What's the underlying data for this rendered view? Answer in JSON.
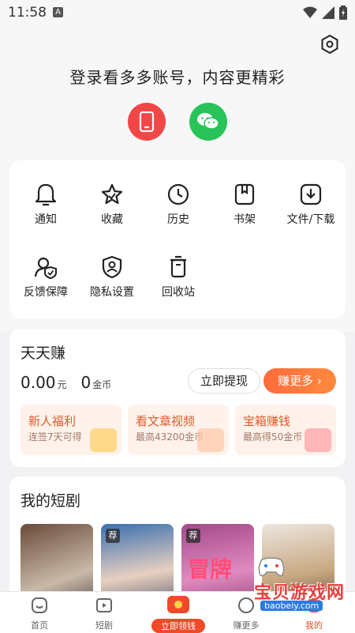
{
  "status_bar": {
    "time": "11:58",
    "notification": "A"
  },
  "login": {
    "title": "登录看多多账号，内容更精彩"
  },
  "tools": [
    {
      "label": "通知",
      "icon": "bell-icon"
    },
    {
      "label": "收藏",
      "icon": "star-icon"
    },
    {
      "label": "历史",
      "icon": "clock-icon"
    },
    {
      "label": "书架",
      "icon": "bookmark-icon"
    },
    {
      "label": "文件/下载",
      "icon": "download-icon"
    },
    {
      "label": "反馈保障",
      "icon": "feedback-icon"
    },
    {
      "label": "隐私设置",
      "icon": "privacy-icon"
    },
    {
      "label": "回收站",
      "icon": "trash-icon"
    }
  ],
  "earn": {
    "title": "天天赚",
    "cash_value": "0.00",
    "cash_unit": "元",
    "coin_value": "0",
    "coin_unit": "金币",
    "withdraw_label": "立即提现",
    "more_label": "赚更多 ›",
    "promos": [
      {
        "title": "新人福利",
        "subtitle": "连签7天可得"
      },
      {
        "title": "看文章视频",
        "subtitle": "最高43200金币"
      },
      {
        "title": "宝箱赚钱",
        "subtitle": "最高得50金币"
      }
    ]
  },
  "dramas": {
    "title": "我的短剧",
    "rec_tag": "荐",
    "poster_text": "冒牌"
  },
  "nav": [
    {
      "label": "首页"
    },
    {
      "label": "短剧"
    },
    {
      "label": "立即领钱"
    },
    {
      "label": "赚更多"
    },
    {
      "label": "我的"
    }
  ],
  "watermark": {
    "text": "宝贝游戏网",
    "url": "baobeiy.com"
  },
  "colors": {
    "accent": "#ff6a3d",
    "red": "#f24747",
    "green": "#28c45a"
  }
}
